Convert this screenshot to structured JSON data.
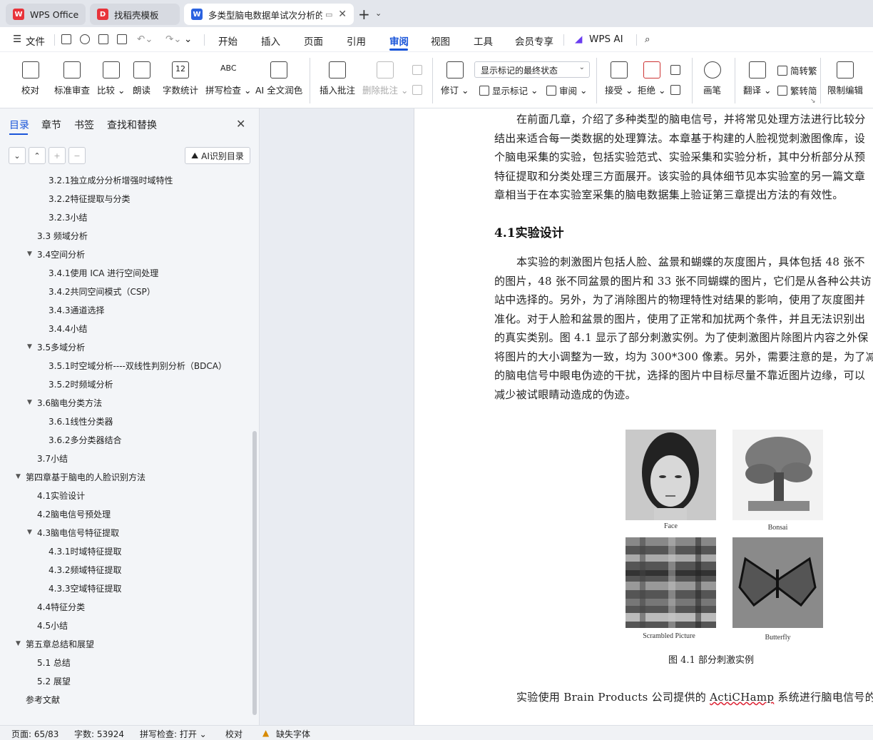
{
  "tabs": [
    {
      "label": "WPS Office",
      "icon": "wps-icon"
    },
    {
      "label": "找稻壳模板",
      "icon": "docer-icon"
    },
    {
      "label": "多类型脑电数据单试次分析的",
      "icon": "writer-icon"
    }
  ],
  "menu": {
    "file": "文件",
    "items": [
      "开始",
      "插入",
      "页面",
      "引用",
      "审阅",
      "视图",
      "工具",
      "会员专享",
      "WPS AI"
    ],
    "active": "审阅"
  },
  "ribbon": {
    "proofread": "校对",
    "standard_review": "标准审查",
    "compare": "比较",
    "read_aloud": "朗读",
    "word_count": "字数统计",
    "spell_check": "拼写检查",
    "ai_polish": "AI 全文润色",
    "insert_comment": "插入批注",
    "delete_comment": "删除批注",
    "track_changes": "修订",
    "markup_mode": "显示标记的最终状态",
    "show_markup": "显示标记",
    "review": "审阅",
    "accept": "接受",
    "reject": "拒绝",
    "pen": "画笔",
    "translate": "翻译",
    "trad_simp": "简转繁",
    "simp_trad": "繁转简",
    "restrict_edit": "限制编辑",
    "icon_word_count": "12",
    "icon_spell": "ABC"
  },
  "sidebar": {
    "tabs": [
      "目录",
      "章节",
      "书签",
      "查找和替换"
    ],
    "ai_toc": "AI识别目录",
    "toc": [
      {
        "label": "3.2.1独立成分分析增强时域特性",
        "level": 3,
        "arrow": ""
      },
      {
        "label": "3.2.2特征提取与分类",
        "level": 3,
        "arrow": ""
      },
      {
        "label": "3.2.3小结",
        "level": 3,
        "arrow": ""
      },
      {
        "label": "3.3  频域分析",
        "level": 2,
        "arrow": ""
      },
      {
        "label": "3.4空间分析",
        "level": 2,
        "arrow": "▼"
      },
      {
        "label": "3.4.1使用 ICA 进行空间处理",
        "level": 3,
        "arrow": ""
      },
      {
        "label": "3.4.2共同空间模式（CSP）",
        "level": 3,
        "arrow": ""
      },
      {
        "label": "3.4.3通道选择",
        "level": 3,
        "arrow": ""
      },
      {
        "label": "3.4.4小结",
        "level": 3,
        "arrow": ""
      },
      {
        "label": "3.5多域分析",
        "level": 2,
        "arrow": "▼"
      },
      {
        "label": "3.5.1时空域分析----双线性判别分析（BDCA）",
        "level": 3,
        "arrow": ""
      },
      {
        "label": "3.5.2时频域分析",
        "level": 3,
        "arrow": ""
      },
      {
        "label": "3.6脑电分类方法",
        "level": 2,
        "arrow": "▼"
      },
      {
        "label": "3.6.1线性分类器",
        "level": 3,
        "arrow": ""
      },
      {
        "label": "3.6.2多分类器结合",
        "level": 3,
        "arrow": ""
      },
      {
        "label": "3.7小结",
        "level": 2,
        "arrow": ""
      },
      {
        "label": "第四章基于脑电的人脸识别方法",
        "level": 1,
        "arrow": "▼"
      },
      {
        "label": "4.1实验设计",
        "level": 2,
        "arrow": ""
      },
      {
        "label": "4.2脑电信号预处理",
        "level": 2,
        "arrow": ""
      },
      {
        "label": "4.3脑电信号特征提取",
        "level": 2,
        "arrow": "▼"
      },
      {
        "label": "4.3.1时域特征提取",
        "level": 3,
        "arrow": ""
      },
      {
        "label": "4.3.2频域特征提取",
        "level": 3,
        "arrow": ""
      },
      {
        "label": "4.3.3空域特征提取",
        "level": 3,
        "arrow": ""
      },
      {
        "label": "4.4特征分类",
        "level": 2,
        "arrow": ""
      },
      {
        "label": "4.5小结",
        "level": 2,
        "arrow": ""
      },
      {
        "label": "第五章总结和展望",
        "level": 1,
        "arrow": "▼"
      },
      {
        "label": "5.1  总结",
        "level": 2,
        "arrow": ""
      },
      {
        "label": "5.2  展望",
        "level": 2,
        "arrow": ""
      },
      {
        "label": "参考文献",
        "level": 1,
        "arrow": ""
      }
    ]
  },
  "doc": {
    "para1": [
      "在前面几章，介绍了多种类型的脑电信号，并将常见处理方法进行比较分",
      "结出来适合每一类数据的处理算法。本章基于构建的人脸视觉刺激图像库，设",
      "个脑电采集的实验，包括实验范式、实验采集和实验分析，其中分析部分从预",
      "特征提取和分类处理三方面展开。该实验的具体细节见本实验室的另一篇文章",
      "章相当于在本实验室采集的脑电数据集上验证第三章提出方法的有效性。"
    ],
    "heading": "4.1实验设计",
    "para2": [
      "本实验的刺激图片包括人脸、盆景和蝴蝶的灰度图片，具体包括 48 张不",
      "的图片，48 张不同盆景的图片和 33 张不同蝴蝶的图片，它们是从各种公共访",
      "站中选择的。另外，为了消除图片的物理特性对结果的影响，使用了灰度图并",
      "准化。对于人脸和盆景的图片，使用了正常和加扰两个条件，并且无法识别出",
      "的真实类别。图 4.1 显示了部分刺激实例。为了使刺激图片除图片内容之外保",
      "将图片的大小调整为一致，均为 300*300 像素。另外，需要注意的是，为了减",
      "的脑电信号中眼电伪迹的干扰，选择的图片中目标尽量不靠近图片边缘，可以",
      "减少被试眼睛动造成的伪迹。"
    ],
    "figure_labels": [
      "Face",
      "Bonsai",
      "Scrambled  Picture",
      "Butterfly"
    ],
    "figure_caption": "图 4.1  部分刺激实例",
    "para3_pre": "实验使用 Brain Products 公司提供的 ",
    "para3_mark": "ActiCHamp",
    "para3_post": " 系统进行脑电信号的采集"
  },
  "status": {
    "page": "页面: 65/83",
    "words": "字数: 53924",
    "spell": "拼写检查: 打开",
    "proof": "校对",
    "missing_font": "缺失字体"
  }
}
